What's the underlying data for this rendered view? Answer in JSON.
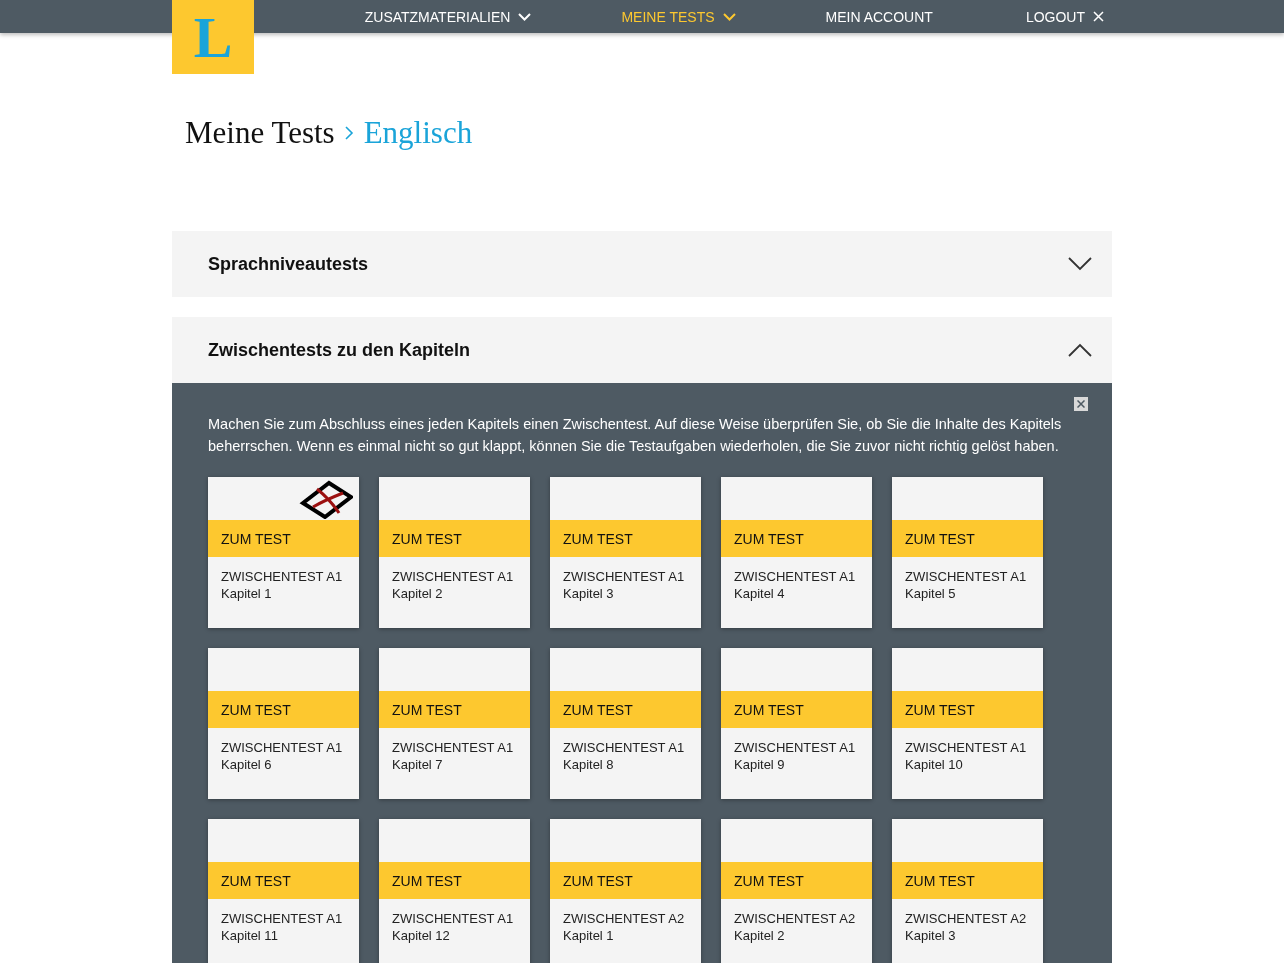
{
  "nav": {
    "logo": "L",
    "items": [
      {
        "label": "ZUSATZMATERIALIEN",
        "kind": "dropdown",
        "selected": false
      },
      {
        "label": "MEINE TESTS",
        "kind": "dropdown",
        "selected": true
      },
      {
        "label": "MEIN ACCOUNT",
        "kind": "link",
        "selected": false
      },
      {
        "label": "LOGOUT",
        "kind": "logout",
        "selected": false
      }
    ]
  },
  "breadcrumb": [
    "Meine Tests",
    "Englisch"
  ],
  "sections": [
    {
      "title": "Sprachniveautests",
      "expanded": false
    },
    {
      "title": "Zwischentests zu den Kapiteln",
      "expanded": true,
      "intro": "Machen Sie zum Abschluss eines jeden Kapitels einen Zwischentest. Auf diese Weise überprüfen Sie, ob Sie die Inhalte des Kapitels beherrschen. Wenn es einmal nicht so gut klappt, können Sie die Testaufgaben wiederholen, die Sie zuvor nicht richtig gelöst haben.",
      "cards": [
        {
          "button": "ZUM TEST",
          "title": "ZWISCHENTEST A1",
          "subtitle": "Kapitel 1",
          "completed": true
        },
        {
          "button": "ZUM TEST",
          "title": "ZWISCHENTEST A1",
          "subtitle": "Kapitel 2",
          "completed": false
        },
        {
          "button": "ZUM TEST",
          "title": "ZWISCHENTEST A1",
          "subtitle": "Kapitel 3",
          "completed": false
        },
        {
          "button": "ZUM TEST",
          "title": "ZWISCHENTEST A1",
          "subtitle": "Kapitel 4",
          "completed": false
        },
        {
          "button": "ZUM TEST",
          "title": "ZWISCHENTEST A1",
          "subtitle": "Kapitel 5",
          "completed": false
        },
        {
          "button": "ZUM TEST",
          "title": "ZWISCHENTEST A1",
          "subtitle": "Kapitel 6",
          "completed": false
        },
        {
          "button": "ZUM TEST",
          "title": "ZWISCHENTEST A1",
          "subtitle": "Kapitel 7",
          "completed": false
        },
        {
          "button": "ZUM TEST",
          "title": "ZWISCHENTEST A1",
          "subtitle": "Kapitel 8",
          "completed": false
        },
        {
          "button": "ZUM TEST",
          "title": "ZWISCHENTEST A1",
          "subtitle": "Kapitel 9",
          "completed": false
        },
        {
          "button": "ZUM TEST",
          "title": "ZWISCHENTEST A1",
          "subtitle": "Kapitel 10",
          "completed": false
        },
        {
          "button": "ZUM TEST",
          "title": "ZWISCHENTEST A1",
          "subtitle": "Kapitel 11",
          "completed": false
        },
        {
          "button": "ZUM TEST",
          "title": "ZWISCHENTEST A1",
          "subtitle": "Kapitel 12",
          "completed": false
        },
        {
          "button": "ZUM TEST",
          "title": "ZWISCHENTEST A2",
          "subtitle": "Kapitel 1",
          "completed": false
        },
        {
          "button": "ZUM TEST",
          "title": "ZWISCHENTEST A2",
          "subtitle": "Kapitel 2",
          "completed": false
        },
        {
          "button": "ZUM TEST",
          "title": "ZWISCHENTEST A2",
          "subtitle": "Kapitel 3",
          "completed": false
        }
      ]
    }
  ]
}
